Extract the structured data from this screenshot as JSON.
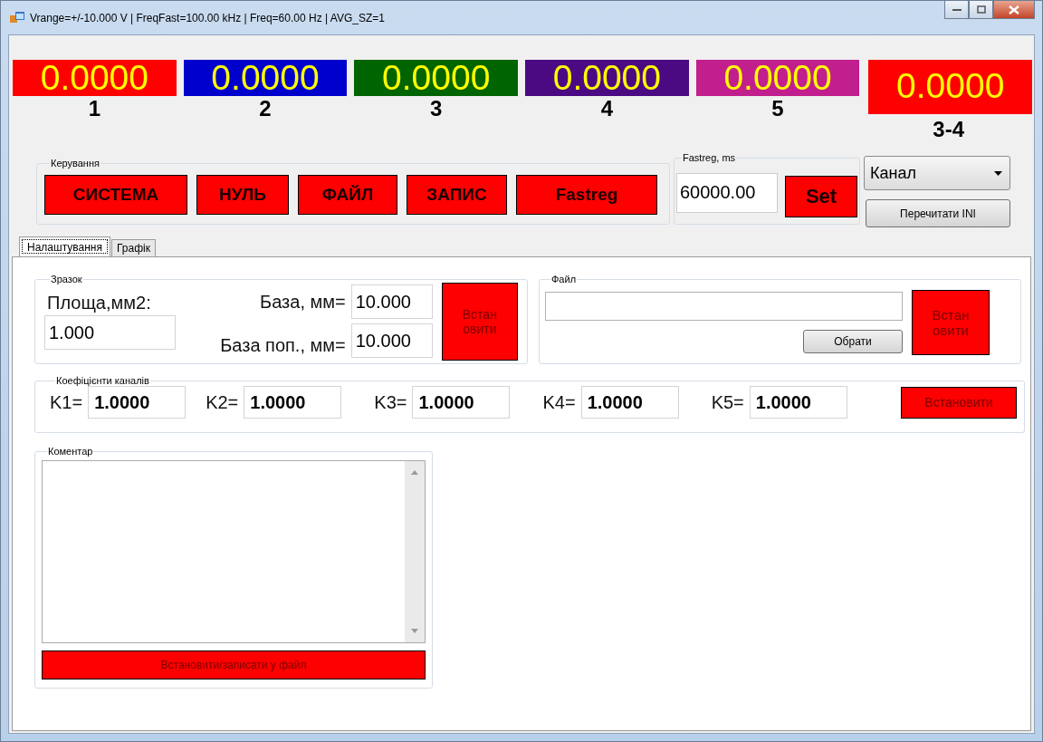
{
  "window": {
    "title": "Vrange=+/-10.000 V | FreqFast=100.00 kHz | Freq=60.00 Hz | AVG_SZ=1"
  },
  "displays": [
    {
      "value": "0.0000",
      "label": "1",
      "color": "#ff0000"
    },
    {
      "value": "0.0000",
      "label": "2",
      "color": "#0000cc"
    },
    {
      "value": "0.0000",
      "label": "3",
      "color": "#006400"
    },
    {
      "value": "0.0000",
      "label": "4",
      "color": "#4b0a82"
    },
    {
      "value": "0.0000",
      "label": "5",
      "color": "#c21f8e"
    },
    {
      "value": "0.0000",
      "label": "3-4",
      "color": "#ff0000"
    }
  ],
  "control_group": {
    "title": "Керування",
    "buttons": [
      "СИСТЕМА",
      "НУЛЬ",
      "ФАЙЛ",
      "ЗАПИС",
      "Fastreg"
    ]
  },
  "fastreg": {
    "title": "Fastreg, ms",
    "value": "60000.00",
    "button": "Set"
  },
  "channel_dropdown": {
    "value": "Канал"
  },
  "reread_button": "Перечитати INI",
  "tabs": [
    {
      "label": "Налаштування",
      "selected": true
    },
    {
      "label": "Графік",
      "selected": false
    }
  ],
  "sample_group": {
    "title": "Зразок",
    "area_label": "Площа,мм2:",
    "area_value": "1.000",
    "base_label": "База, мм=",
    "base_value": "10.000",
    "base_cross_label": "База поп., мм=",
    "base_cross_value": "10.000",
    "button": "Встан овити"
  },
  "file_group": {
    "title": "Файл",
    "browse_button": "Обрати",
    "button": "Встан овити"
  },
  "coefficients_group": {
    "title": "Коефіцієнти каналів",
    "items": [
      {
        "label": "K1=",
        "value": "1.0000"
      },
      {
        "label": "K2=",
        "value": "1.0000"
      },
      {
        "label": "K3=",
        "value": "1.0000"
      },
      {
        "label": "K4=",
        "value": "1.0000"
      },
      {
        "label": "K5=",
        "value": "1.0000"
      }
    ],
    "button": "Встановити"
  },
  "comment_group": {
    "title": "Коментар",
    "button": "Встановити/записати у файл"
  }
}
